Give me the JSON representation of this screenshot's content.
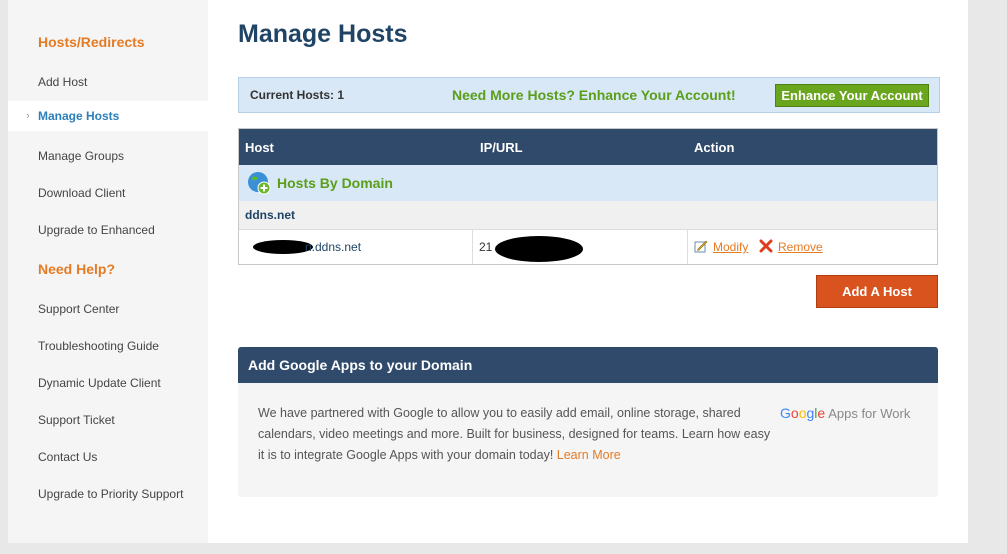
{
  "sidebar": {
    "section1_heading": "Hosts/Redirects",
    "items1": [
      {
        "label": "Add Host"
      },
      {
        "label": "Manage Hosts"
      },
      {
        "label": "Manage Groups"
      },
      {
        "label": "Download Client"
      },
      {
        "label": "Upgrade to Enhanced"
      }
    ],
    "active_chevron": "›",
    "section2_heading": "Need Help?",
    "items2": [
      {
        "label": "Support Center"
      },
      {
        "label": "Troubleshooting Guide"
      },
      {
        "label": "Dynamic Update Client"
      },
      {
        "label": "Support Ticket"
      },
      {
        "label": "Contact Us"
      },
      {
        "label": "Upgrade to Priority Support"
      }
    ]
  },
  "main": {
    "title": "Manage Hosts",
    "banner": {
      "current_label": "Current Hosts:",
      "current_count": "1",
      "promo": "Need More Hosts? Enhance Your Account!",
      "button": "Enhance Your Account"
    },
    "table": {
      "columns": [
        "Host",
        "IP/URL",
        "Action"
      ],
      "group_label": "Hosts By Domain",
      "domain": "ddns.net",
      "row": {
        "host_visible": "n.ddns.net",
        "ip_visible": "21",
        "modify": "Modify",
        "remove": "Remove"
      }
    },
    "add_host_button": "Add A Host",
    "gapps": {
      "heading": "Add Google Apps to your Domain",
      "body": "We have partnered with Google to allow you to easily add email, online storage, shared calendars, video meetings and more. Built for business, designed for teams. Learn how easy it is to integrate Google Apps with your domain today! ",
      "link": "Learn More",
      "logo_word": "Google",
      "logo_suffix": "Apps for Work"
    }
  },
  "colors": {
    "accent_orange": "#e47b25",
    "header_navy": "#2f4a6b",
    "promo_green": "#5a9e1a",
    "add_button": "#d9531e"
  }
}
